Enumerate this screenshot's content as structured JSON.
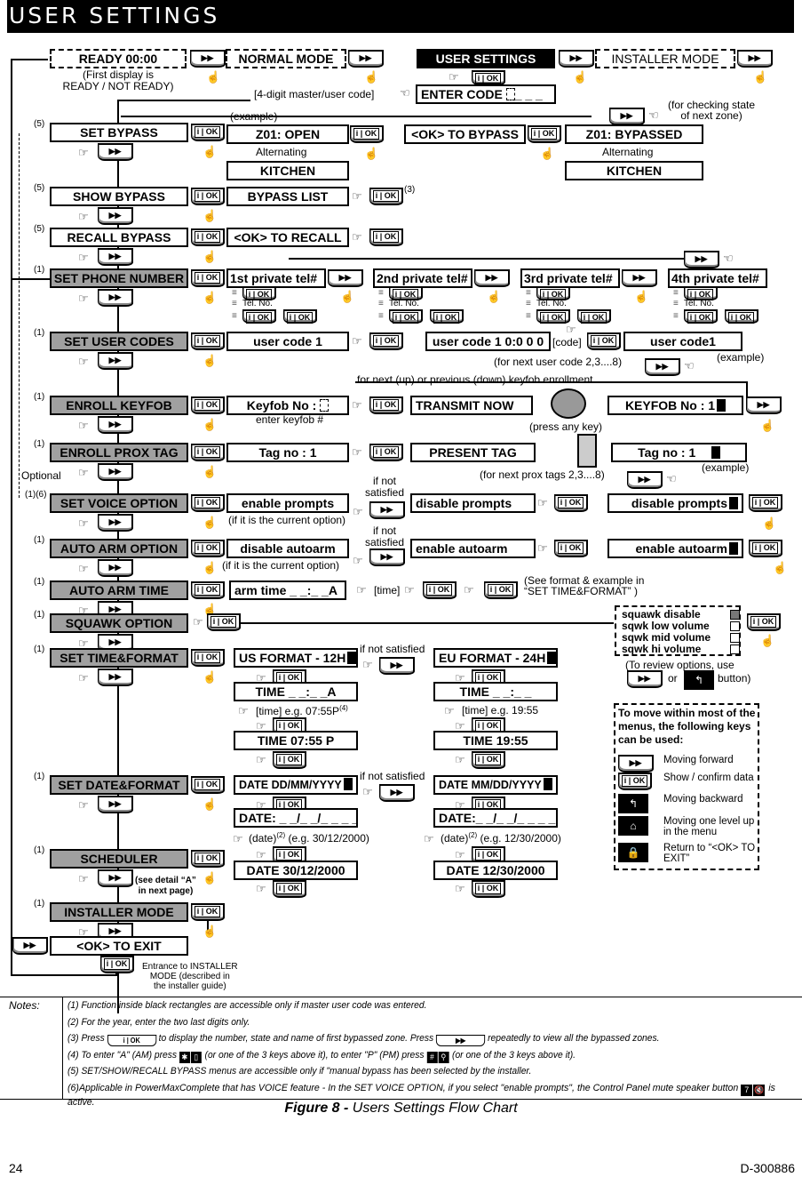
{
  "header": {
    "title": "USER SETTINGS"
  },
  "top_row": {
    "ready": "READY 00:00",
    "ready_note": "(First display is\nREADY / NOT READY)",
    "normal_mode": "NORMAL MODE",
    "user_settings": "USER SETTINGS",
    "installer_mode": "INSTALLER MODE",
    "enter_code": "ENTER CODE",
    "enter_code_mask": "_ _ _",
    "code_hint": "[4-digit master/user code]",
    "example": "(example)",
    "next_zone_note": "(for checking state\nof next zone)"
  },
  "keys": {
    "forward": "▶▶",
    "ok": "i | OK",
    "back": "↰",
    "home": "⌂",
    "lock": "🔒"
  },
  "menu": [
    {
      "id": "set-bypass",
      "label": "SET BYPASS",
      "ref": "(5)",
      "style": "white"
    },
    {
      "id": "show-bypass",
      "label": "SHOW BYPASS",
      "ref": "(5)",
      "style": "white"
    },
    {
      "id": "recall-bypass",
      "label": "RECALL BYPASS",
      "ref": "(5)",
      "style": "white"
    },
    {
      "id": "set-phone-number",
      "label": "SET PHONE NUMBER",
      "ref": "(1)",
      "style": "gray"
    },
    {
      "id": "set-user-codes",
      "label": "SET USER CODES",
      "ref": "(1)",
      "style": "gray"
    },
    {
      "id": "enroll-keyfob",
      "label": "ENROLL KEYFOB",
      "ref": "(1)",
      "style": "gray"
    },
    {
      "id": "enroll-prox-tag",
      "label": "ENROLL PROX TAG",
      "ref": "(1)",
      "style": "gray"
    },
    {
      "id": "set-voice-option",
      "label": "SET VOICE OPTION",
      "ref": "(1)(6)",
      "style": "gray"
    },
    {
      "id": "auto-arm-option",
      "label": "AUTO ARM OPTION",
      "ref": "(1)",
      "style": "gray"
    },
    {
      "id": "auto-arm-time",
      "label": "AUTO ARM TIME",
      "ref": "(1)",
      "style": "gray"
    },
    {
      "id": "squawk-option",
      "label": "SQUAWK OPTION",
      "ref": "(1)",
      "style": "gray"
    },
    {
      "id": "set-time-format",
      "label": "SET TIME&FORMAT",
      "ref": "(1)",
      "style": "gray"
    },
    {
      "id": "set-date-format",
      "label": "SET DATE&FORMAT",
      "ref": "(1)",
      "style": "gray"
    },
    {
      "id": "scheduler",
      "label": "SCHEDULER",
      "ref": "(1)",
      "style": "gray"
    },
    {
      "id": "installer-mode",
      "label": "INSTALLER MODE",
      "ref": "(1)",
      "style": "gray"
    },
    {
      "id": "ok-to-exit",
      "label": "<OK> TO EXIT",
      "ref": "",
      "style": "white"
    }
  ],
  "bypass": {
    "z01_open": "Z01: OPEN",
    "alternating": "Alternating",
    "kitchen": "KITCHEN",
    "ok_to_bypass": "<OK> TO BYPASS",
    "z01_bypassed": "Z01: BYPASSED",
    "bypass_list": "BYPASS LIST",
    "bypass_list_ref": "(3)",
    "ok_to_recall": "<OK> TO RECALL"
  },
  "phone": {
    "tels": [
      "1st private tel#",
      "2nd private tel#",
      "3rd private tel#",
      "4th private tel#"
    ],
    "tel_no": "Tel. No."
  },
  "user_codes": {
    "code1": "user code 1",
    "code1_entry": "user code 1 0:0 0 0",
    "code_hint": "[code]",
    "code1_result": "user code1",
    "next_note": "(for next user code 2,3....8)",
    "example": "(example)"
  },
  "keyfob": {
    "loop_note": "for next (up) or previous (down)  keyfob enrollment",
    "keyfob_no": "Keyfob No :",
    "enter_hint": "enter keyfob #",
    "transmit_now": "TRANSMIT NOW",
    "press_any_key": "(press any key)",
    "result": "KEYFOB No : 1"
  },
  "prox": {
    "tag_no": "Tag no   : 1",
    "present_tag": "PRESENT TAG",
    "result": "Tag no   :   1",
    "next_note": "(for next prox tags 2,3....8)",
    "example": "(example)",
    "optional": "Optional"
  },
  "voice": {
    "enable": "enable prompts",
    "current_hint": "(if it is the current option)",
    "if_not": "if not",
    "satisfied": "satisfied",
    "disable": "disable prompts",
    "result": "disable prompts"
  },
  "autoarm": {
    "disable": "disable autoarm",
    "current_hint": "(if it is the current option)",
    "enable": "enable autoarm",
    "result": "enable autoarm"
  },
  "autoarm_time": {
    "field": "arm time _ _:_ _A",
    "time_hint": "[time]",
    "see_note": "(See format & example in\n“SET TIME&FORMAT” )"
  },
  "squawk": {
    "options": [
      {
        "label": "squawk disable",
        "selected": true
      },
      {
        "label": "sqwk low volume",
        "selected": false
      },
      {
        "label": "sqwk mid volume",
        "selected": false
      },
      {
        "label": "sqwk hi volume",
        "selected": false
      }
    ],
    "review_note_a": "(To review options, use",
    "review_or": "or",
    "review_button": "button)"
  },
  "time_format": {
    "us": "US FORMAT - 12H",
    "eu": "EU FORMAT - 24H",
    "if_not_satisfied": "if not satisfied",
    "us_field": "TIME _ _:_ _A",
    "eu_field": "TIME _ _:_ _",
    "us_hint": "[time] e.g. 07:55P",
    "us_hint_ref": "(4)",
    "eu_hint": "[time] e.g. 19:55",
    "us_result": "TIME 07:55 P",
    "eu_result": "TIME 19:55"
  },
  "date_format": {
    "dd": "DATE DD/MM/YYYY",
    "mm": "DATE MM/DD/YYYY",
    "if_not_satisfied": "if not satisfied",
    "dd_field": "DATE: _ _/_ _/_ _ _ _",
    "mm_field": "DATE:_ _/_ _/_ _ _ _",
    "dd_hint": "(date)",
    "dd_hint_ex": "(e.g. 30/12/2000)",
    "mm_hint": "(date)",
    "mm_hint_ex": "(e.g. 12/30/2000)",
    "hint_ref": "(2)",
    "dd_result": "DATE 30/12/2000",
    "mm_result": "DATE 12/30/2000"
  },
  "scheduler": {
    "detail_note": "(see detail “A”\nin next page)"
  },
  "installer": {
    "entrance_note": "Entrance to INSTALLER\nMODE (described in\nthe installer guide)"
  },
  "legend": {
    "title": "To move within most of the menus, the following keys can be used:",
    "items": [
      {
        "key": "forward",
        "label": "Moving forward"
      },
      {
        "key": "ok",
        "label": "Show / confirm data"
      },
      {
        "key": "back",
        "label": "Moving backward"
      },
      {
        "key": "home",
        "label": "Moving one level up in the menu"
      },
      {
        "key": "lock",
        "label": "Return to “<OK> TO EXIT”"
      }
    ]
  },
  "notes": {
    "label": "Notes:",
    "items": [
      "(1) Function inside black rectangles are accessible only if master user code was entered.",
      "(2) For the year, enter the two last digits only.",
      "(3) Press",
      "(4) To enter \"A\" (AM) press",
      "(5) SET/SHOW/RECALL BYPASS menus are accessible only if \"manual bypass has been selected by the installer.",
      "(6)Applicable in PowerMaxComplete that has VOICE feature -  In the SET VOICE OPTION, if you select \"enable prompts\", the Control Panel mute speaker button"
    ],
    "n3_mid": "to display the number, state and name of first bypassed zone. Press",
    "n3_end": "repeatedly to view all the bypassed zones.",
    "n4_mid": "(or one of the 3 keys above it), to enter \"P\" (PM) press",
    "n4_end": "(or one of the 3 keys above it).",
    "n6_end": "is active."
  },
  "caption": {
    "bold": "Figure 8 -",
    "rest": " Users Settings Flow Chart"
  },
  "footer": {
    "page": "24",
    "doc": "D-300886"
  }
}
